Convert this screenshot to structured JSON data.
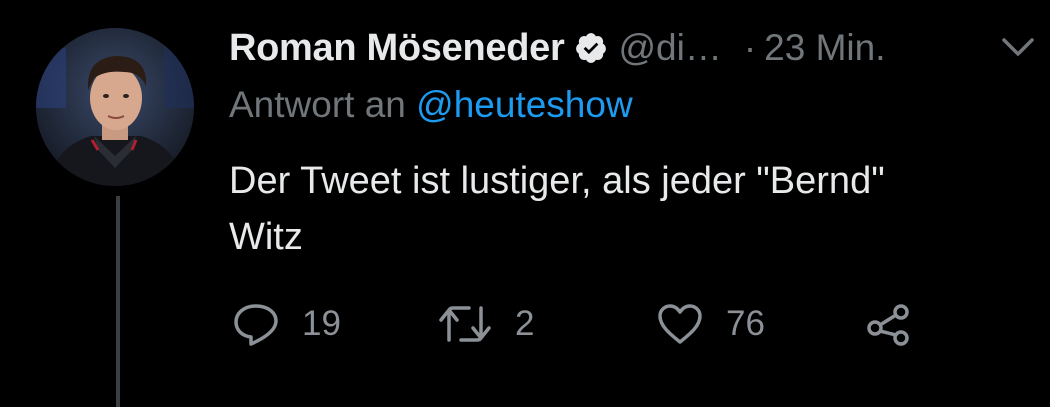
{
  "tweet": {
    "author_name": "Roman Möseneder",
    "handle": "@di…",
    "separator": "·",
    "time": "23 Min.",
    "reply_prefix": "Antwort an",
    "reply_mention": "@heuteshow",
    "text_line1": "Der Tweet ist lustiger, als jeder \"Bernd\"",
    "text_line2": "Witz",
    "replies": "19",
    "retweets": "2",
    "likes": "76"
  },
  "icons": {
    "verified": "verified-badge-icon",
    "menu": "chevron-down-icon",
    "reply": "reply-icon",
    "retweet": "retweet-icon",
    "like": "heart-icon",
    "share": "share-icon"
  },
  "colors": {
    "background": "#000000",
    "text": "#e7e9ea",
    "muted": "#71767b",
    "link": "#1d9bf0",
    "thread_line": "#3a3f44"
  }
}
